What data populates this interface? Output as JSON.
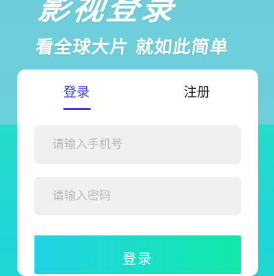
{
  "hero": {
    "title": "影视登录",
    "slogan": "看全球大片 就如此简单"
  },
  "tabs": {
    "login_label": "登录",
    "register_label": "注册"
  },
  "form": {
    "phone_placeholder": "请输入手机号",
    "phone_value": "",
    "password_placeholder": "请输入密码",
    "password_value": "",
    "submit_label": "登录"
  },
  "colors": {
    "accent": "#3b3fc9",
    "hero_background": "#6fcdd9",
    "page_background": "#1fd6d2",
    "button_gradient_start": "#22d3e6",
    "button_gradient_end": "#12e8a8",
    "field_background": "#f0f0f0"
  }
}
